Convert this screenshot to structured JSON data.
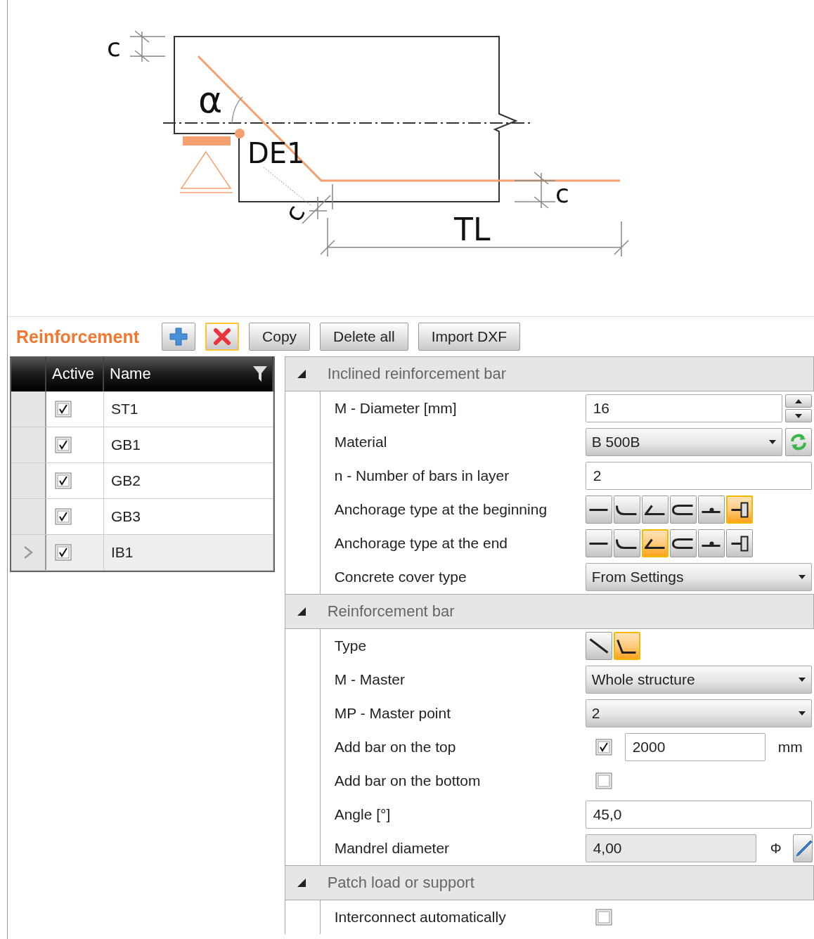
{
  "diagram": {
    "labels": [
      {
        "kind": "dimension",
        "text": "c"
      },
      {
        "kind": "angle",
        "text": "α"
      },
      {
        "kind": "bar",
        "text": "DE1"
      },
      {
        "kind": "dimension",
        "text": "c"
      },
      {
        "kind": "dimension",
        "text": "c"
      },
      {
        "kind": "length",
        "text": "TL"
      }
    ]
  },
  "toolbar": {
    "title": "Reinforcement",
    "buttons": [
      {
        "kind": "add"
      },
      {
        "kind": "delete"
      },
      {
        "kind": "text",
        "label": "Copy"
      },
      {
        "kind": "text",
        "label": "Delete all"
      },
      {
        "kind": "text",
        "label": "Import DXF"
      }
    ]
  },
  "table": {
    "columns": [
      "Active",
      "Name"
    ],
    "rows": [
      {
        "active": true,
        "name": "ST1",
        "selected": false
      },
      {
        "active": true,
        "name": "GB1",
        "selected": false
      },
      {
        "active": true,
        "name": "GB2",
        "selected": false
      },
      {
        "active": true,
        "name": "GB3",
        "selected": false
      },
      {
        "active": true,
        "name": "IB1",
        "selected": true
      }
    ]
  },
  "properties": {
    "sections": [
      {
        "title": "Inclined reinforcement bar",
        "expanded": true,
        "rows": [
          {
            "kind": "spin",
            "label": "M - Diameter [mm]",
            "value": "16"
          },
          {
            "kind": "dropdown_refresh",
            "label": "Material",
            "value": "B 500B"
          },
          {
            "kind": "text",
            "label": "n - Number of bars in layer",
            "value": "2"
          },
          {
            "kind": "icons",
            "label": "Anchorage type at the beginning",
            "options": [
              {
                "kind": "straight",
                "selected": false
              },
              {
                "kind": "bend",
                "selected": false
              },
              {
                "kind": "hook",
                "selected": false
              },
              {
                "kind": "loop",
                "selected": false
              },
              {
                "kind": "weld",
                "selected": false
              },
              {
                "kind": "plate",
                "selected": true
              }
            ]
          },
          {
            "kind": "icons",
            "label": "Anchorage type at the end",
            "options": [
              {
                "kind": "straight",
                "selected": false
              },
              {
                "kind": "bend",
                "selected": false
              },
              {
                "kind": "hook",
                "selected": true
              },
              {
                "kind": "loop",
                "selected": false
              },
              {
                "kind": "weld",
                "selected": false
              },
              {
                "kind": "plate",
                "selected": false
              }
            ]
          },
          {
            "kind": "dropdown",
            "label": "Concrete cover type",
            "value": "From Settings"
          }
        ]
      },
      {
        "title": "Reinforcement bar",
        "expanded": true,
        "rows": [
          {
            "kind": "icons",
            "label": "Type",
            "options": [
              {
                "kind": "inclined",
                "selected": false
              },
              {
                "kind": "bent",
                "selected": true
              }
            ]
          },
          {
            "kind": "dropdown",
            "label": "M - Master",
            "value": "Whole structure"
          },
          {
            "kind": "dropdown",
            "label": "MP - Master point",
            "value": "2"
          },
          {
            "kind": "check_text",
            "label": "Add bar on the top",
            "checked": true,
            "value": "2000",
            "unit": "mm"
          },
          {
            "kind": "check",
            "label": "Add bar on the bottom",
            "checked": false
          },
          {
            "kind": "text",
            "label": "Angle [°]",
            "value": "45,0"
          },
          {
            "kind": "readonly_edit",
            "label": "Mandrel diameter",
            "value": "4,00",
            "symbol": "Φ"
          }
        ]
      },
      {
        "title": "Patch load or support",
        "expanded": true,
        "rows": [
          {
            "kind": "check",
            "label": "Interconnect automatically",
            "checked": false
          }
        ]
      }
    ]
  }
}
